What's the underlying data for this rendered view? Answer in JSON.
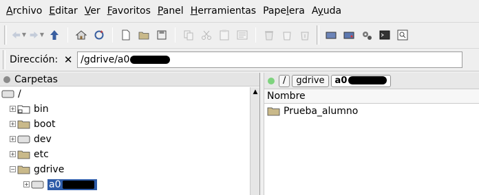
{
  "menu": [
    {
      "name": "menu-archivo",
      "pre": "",
      "ul": "A",
      "post": "rchivo"
    },
    {
      "name": "menu-editar",
      "pre": "",
      "ul": "E",
      "post": "ditar"
    },
    {
      "name": "menu-ver",
      "pre": "",
      "ul": "V",
      "post": "er"
    },
    {
      "name": "menu-favoritos",
      "pre": "",
      "ul": "F",
      "post": "avoritos"
    },
    {
      "name": "menu-panel",
      "pre": "",
      "ul": "P",
      "post": "anel"
    },
    {
      "name": "menu-herramientas",
      "pre": "",
      "ul": "H",
      "post": "erramientas"
    },
    {
      "name": "menu-papelera",
      "pre": "Pape",
      "ul": "l",
      "post": "era"
    },
    {
      "name": "menu-ayuda",
      "pre": "A",
      "ul": "y",
      "post": "uda"
    }
  ],
  "address": {
    "label": "Dirección:",
    "clear_glyph": "✕",
    "value": "/gdrive/a0"
  },
  "left_panel": {
    "title": "Carpetas",
    "dot_color": "#8a8a8a",
    "tree": [
      {
        "label": "/",
        "expander": "",
        "icon": "drive-icon",
        "level": 0
      },
      {
        "label": "bin",
        "expander": "+",
        "icon": "link-folder-icon",
        "level": 1
      },
      {
        "label": "boot",
        "expander": "+",
        "icon": "folder-icon",
        "level": 1
      },
      {
        "label": "dev",
        "expander": "+",
        "icon": "drive-icon",
        "level": 1
      },
      {
        "label": "etc",
        "expander": "+",
        "icon": "folder-icon",
        "level": 1
      },
      {
        "label": "gdrive",
        "expander": "−",
        "icon": "folder-icon",
        "level": 1
      },
      {
        "label": "a0",
        "expander": "+",
        "icon": "drive-icon",
        "level": 2,
        "selected": true
      }
    ]
  },
  "right_panel": {
    "dot_color": "#7ed37e",
    "crumbs": [
      {
        "label": "/",
        "active": false
      },
      {
        "label": "gdrive",
        "active": false
      },
      {
        "label": "a0",
        "active": true
      }
    ],
    "column_header": "Nombre",
    "files": [
      {
        "label": "Prueba_alumno",
        "icon": "folder-icon"
      }
    ]
  },
  "colors": {
    "selection": "#2d5ba8",
    "folder": "#c9b98a"
  }
}
